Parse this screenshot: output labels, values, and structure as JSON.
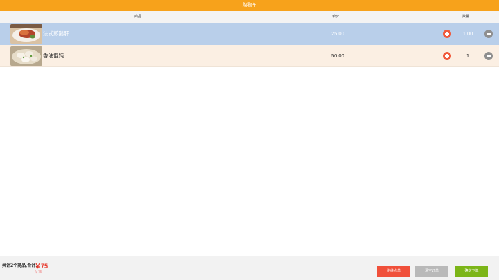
{
  "header": {
    "title": "购物车"
  },
  "columns": {
    "name": "商品",
    "price": "单价",
    "qty": "数量"
  },
  "items": [
    {
      "name": "法式煎鹅肝",
      "price": "25.00",
      "qty": "1.00"
    },
    {
      "name": "香油馄饨",
      "price": "50.00",
      "qty": "1"
    }
  ],
  "footer": {
    "summary": "共计2个商品,合计:",
    "total": "￥75",
    "original_total": "￥75",
    "continue_label": "继续点单",
    "clear_label": "清空订单",
    "confirm_label": "确定下单"
  },
  "colors": {
    "header": "#f7a21b",
    "selected_row": "#b9cfea",
    "row": "#fbefe3",
    "plus": "#f05a3c",
    "minus": "#8f8f8f",
    "continue": "#f0503a",
    "clear": "#b9b9b9",
    "confirm": "#7cb518"
  }
}
